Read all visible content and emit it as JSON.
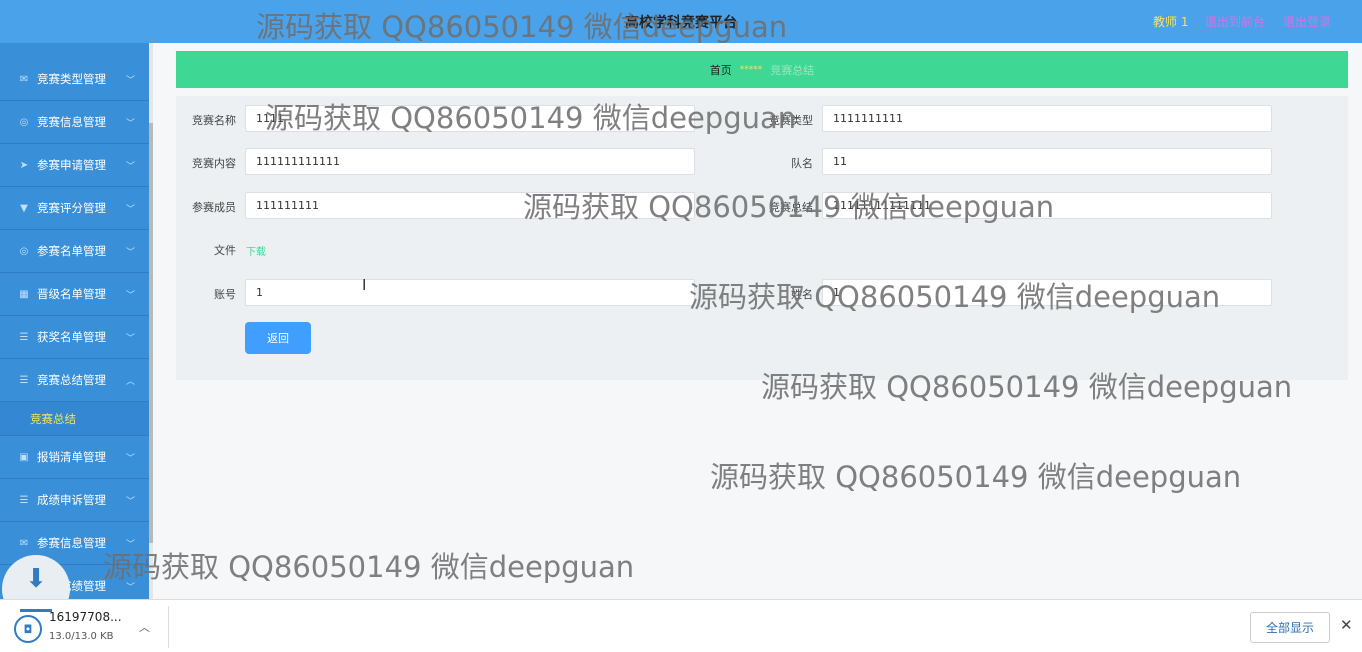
{
  "header": {
    "app_title": "高校学科竞赛平台",
    "user_role": "教师 1",
    "to_front_label": "退出到前台",
    "logout_label": "退出登录"
  },
  "sidebar": {
    "items": [
      {
        "label": "竞赛类型管理",
        "icon": "✉"
      },
      {
        "label": "竞赛信息管理",
        "icon": "◎"
      },
      {
        "label": "参赛申请管理",
        "icon": "➤"
      },
      {
        "label": "竞赛评分管理",
        "icon": "▼"
      },
      {
        "label": "参赛名单管理",
        "icon": "◎"
      },
      {
        "label": "晋级名单管理",
        "icon": "▦"
      },
      {
        "label": "获奖名单管理",
        "icon": "☰"
      },
      {
        "label": "竞赛总结管理",
        "icon": "☰"
      },
      {
        "label": "竞赛总结",
        "icon": ""
      },
      {
        "label": "报销清单管理",
        "icon": "▣"
      },
      {
        "label": "成绩申诉管理",
        "icon": "☰"
      },
      {
        "label": "参赛信息管理",
        "icon": "✉"
      },
      {
        "label": "参赛成绩管理",
        "icon": ""
      }
    ]
  },
  "breadcrumb": {
    "home": "首页",
    "separator": "*****",
    "current": "竞赛总结"
  },
  "form": {
    "competition_name_label": "竞赛名称",
    "competition_name_value": "1111",
    "competition_type_label": "竞赛类型",
    "competition_type_value": "1111111111",
    "content_label": "竞赛内容",
    "content_value": "111111111111",
    "team_label": "队名",
    "team_value": "11",
    "members_label": "参赛成员",
    "members_value": "111111111",
    "summary_label": "竞赛总结",
    "summary_value": "11111111111111",
    "file_label": "文件",
    "file_link": "下载",
    "account_label": "账号",
    "account_value": "1",
    "name_label": "姓名",
    "name_value": "1",
    "back_button": "返回"
  },
  "watermark": "源码获取 QQ86050149 微信deepguan",
  "download_bar": {
    "file_name": "16197708...",
    "file_size": "13.0/13.0 KB",
    "show_all_label": "全部显示",
    "close_glyph": "✕"
  },
  "colors": {
    "header": "#4aa3ea",
    "sidebar": "#3a8fd9",
    "breadcrumb_bar": "#3ed894",
    "primary_button": "#409eff"
  }
}
